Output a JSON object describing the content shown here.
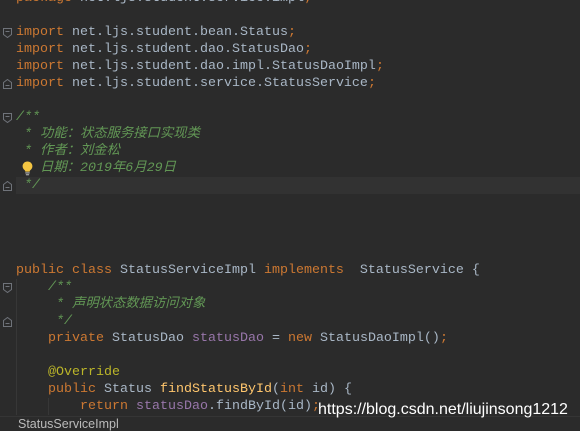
{
  "theme": {
    "editor_background": "#2B2B2B",
    "current_line": "#323232",
    "fold_marker": "#6F737A",
    "indent_guide": "#373737",
    "lightbulb": "#F4C542",
    "breadcrumb_background": "#2B2B2B",
    "breadcrumb_border": "#353535",
    "breadcrumb_text": "#BBBBBB",
    "watermark": "#FFFFFF"
  },
  "editor": {
    "lines": [
      {
        "tokens": [
          {
            "text": "package",
            "color": "#CC7832"
          },
          {
            "text": " net.ljs.student.service.impl",
            "color": "#A9B7C6"
          },
          {
            "text": ";",
            "color": "#CC7832"
          }
        ]
      },
      {
        "tokens": []
      },
      {
        "gutter_icon": "fold-start-icon",
        "tokens": [
          {
            "text": "import",
            "color": "#CC7832"
          },
          {
            "text": " net.ljs.student.bean.Status",
            "color": "#A9B7C6"
          },
          {
            "text": ";",
            "color": "#CC7832"
          }
        ]
      },
      {
        "tokens": [
          {
            "text": "import",
            "color": "#CC7832"
          },
          {
            "text": " net.ljs.student.dao.StatusDao",
            "color": "#A9B7C6"
          },
          {
            "text": ";",
            "color": "#CC7832"
          }
        ]
      },
      {
        "tokens": [
          {
            "text": "import",
            "color": "#CC7832"
          },
          {
            "text": " net.ljs.student.dao.impl.StatusDaoImpl",
            "color": "#A9B7C6"
          },
          {
            "text": ";",
            "color": "#CC7832"
          }
        ]
      },
      {
        "gutter_icon": "fold-end-icon",
        "tokens": [
          {
            "text": "import",
            "color": "#CC7832"
          },
          {
            "text": " net.ljs.student.service.StatusService",
            "color": "#A9B7C6"
          },
          {
            "text": ";",
            "color": "#CC7832"
          }
        ]
      },
      {
        "tokens": []
      },
      {
        "gutter_icon": "fold-start-icon",
        "tokens": [
          {
            "text": "/**",
            "color": "#629755",
            "italic": true
          }
        ]
      },
      {
        "tokens": [
          {
            "text": " * 功能：状态服务接口实现类",
            "color": "#629755",
            "italic": true
          }
        ]
      },
      {
        "tokens": [
          {
            "text": " * 作者：刘金松",
            "color": "#629755",
            "italic": true
          }
        ]
      },
      {
        "tokens": [
          {
            "icon": "lightbulb-icon"
          },
          {
            "text": " 日期：2019年6月29日",
            "color": "#629755",
            "italic": true
          }
        ]
      },
      {
        "current": true,
        "gutter_icon": "fold-end-icon",
        "tokens": [
          {
            "text": " */",
            "color": "#629755",
            "italic": true
          }
        ]
      },
      {
        "tokens": []
      },
      {
        "tokens": []
      },
      {
        "tokens": []
      },
      {
        "tokens": []
      },
      {
        "tokens": [
          {
            "text": "public class",
            "color": "#CC7832"
          },
          {
            "text": " StatusServiceImpl ",
            "color": "#A9B7C6"
          },
          {
            "text": "implements",
            "color": "#CC7832"
          },
          {
            "text": "  StatusService {",
            "color": "#A9B7C6"
          }
        ]
      },
      {
        "gutter_icon": "fold-start-icon",
        "tokens": [
          {
            "text": "    /**",
            "color": "#629755",
            "italic": true
          }
        ]
      },
      {
        "tokens": [
          {
            "text": "     * 声明状态数据访问对象",
            "color": "#629755",
            "italic": true
          }
        ]
      },
      {
        "gutter_icon": "fold-end-icon",
        "tokens": [
          {
            "text": "     */",
            "color": "#629755",
            "italic": true
          }
        ]
      },
      {
        "tokens": [
          {
            "text": "    private",
            "color": "#CC7832"
          },
          {
            "text": " StatusDao ",
            "color": "#A9B7C6"
          },
          {
            "text": "statusDao",
            "color": "#9876AA"
          },
          {
            "text": " = ",
            "color": "#A9B7C6"
          },
          {
            "text": "new",
            "color": "#CC7832"
          },
          {
            "text": " StatusDaoImpl()",
            "color": "#A9B7C6"
          },
          {
            "text": ";",
            "color": "#CC7832"
          }
        ]
      },
      {
        "tokens": []
      },
      {
        "tokens": [
          {
            "text": "    @Override",
            "color": "#BBB529"
          }
        ]
      },
      {
        "tokens": [
          {
            "text": "    public",
            "color": "#CC7832"
          },
          {
            "text": " Status ",
            "color": "#A9B7C6"
          },
          {
            "text": "findStatusById",
            "color": "#FFC66D"
          },
          {
            "text": "(",
            "color": "#A9B7C6"
          },
          {
            "text": "int",
            "color": "#CC7832"
          },
          {
            "text": " id) {",
            "color": "#A9B7C6"
          }
        ]
      },
      {
        "tokens": [
          {
            "text": "        return ",
            "color": "#CC7832"
          },
          {
            "text": "statusDao",
            "color": "#9876AA"
          },
          {
            "text": ".findById(id)",
            "color": "#A9B7C6"
          },
          {
            "text": ";",
            "color": "#CC7832"
          }
        ]
      }
    ]
  },
  "breadcrumb": {
    "items": [
      "StatusServiceImpl"
    ]
  },
  "watermark": {
    "text": "https://blog.csdn.net/liujinsong1212"
  }
}
